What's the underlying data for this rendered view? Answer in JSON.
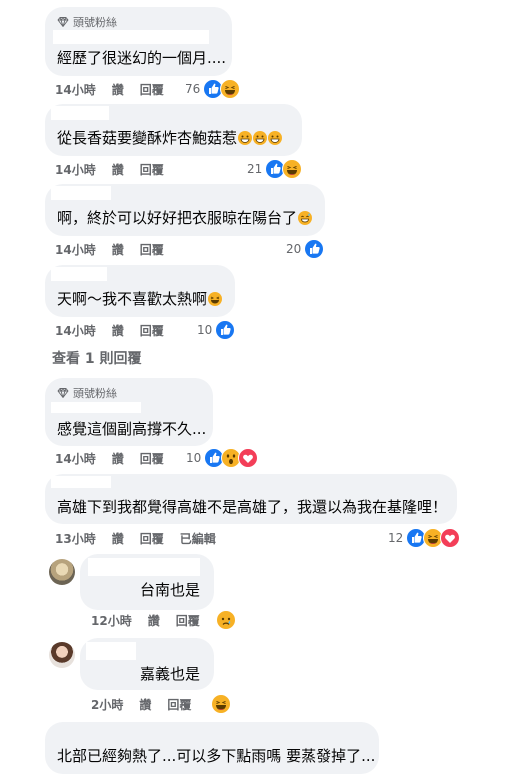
{
  "labels": {
    "fan_badge": "頭號粉絲",
    "reply": "回覆",
    "like": "讚",
    "edited": "已編輯",
    "view_replies": "查看 1 則回覆"
  },
  "comments": [
    {
      "text": "經歷了很迷幻的一個月....",
      "time": "14小時",
      "count": "76"
    },
    {
      "text": "從長香菇要變酥炸杏鮑菇惹",
      "time": "14小時",
      "count": "21"
    },
    {
      "text": "啊，終於可以好好把衣服晾在陽台了",
      "time": "14小時",
      "count": "20"
    },
    {
      "text": "天啊～我不喜歡太熱啊",
      "time": "14小時",
      "count": "10"
    },
    {
      "text": "感覺這個副高撐不久...",
      "time": "14小時",
      "count": "10"
    },
    {
      "text": "高雄下到我都覺得高雄不是高雄了，我還以為我在基隆哩！",
      "time": "13小時",
      "count": "12"
    }
  ],
  "replies": [
    {
      "text": "台南也是",
      "time": "12小時"
    },
    {
      "text": "嘉義也是",
      "time": "2小時"
    }
  ],
  "last_comment": {
    "text": "北部已經夠熱了...可以多下點雨嗎 要蒸發掉了..."
  },
  "colors": {
    "like_blue": "#1877f2",
    "haha_yellow": "#f7b125",
    "love_red": "#f33e58",
    "bubble": "#f0f2f5",
    "meta_gray": "#65676b"
  }
}
